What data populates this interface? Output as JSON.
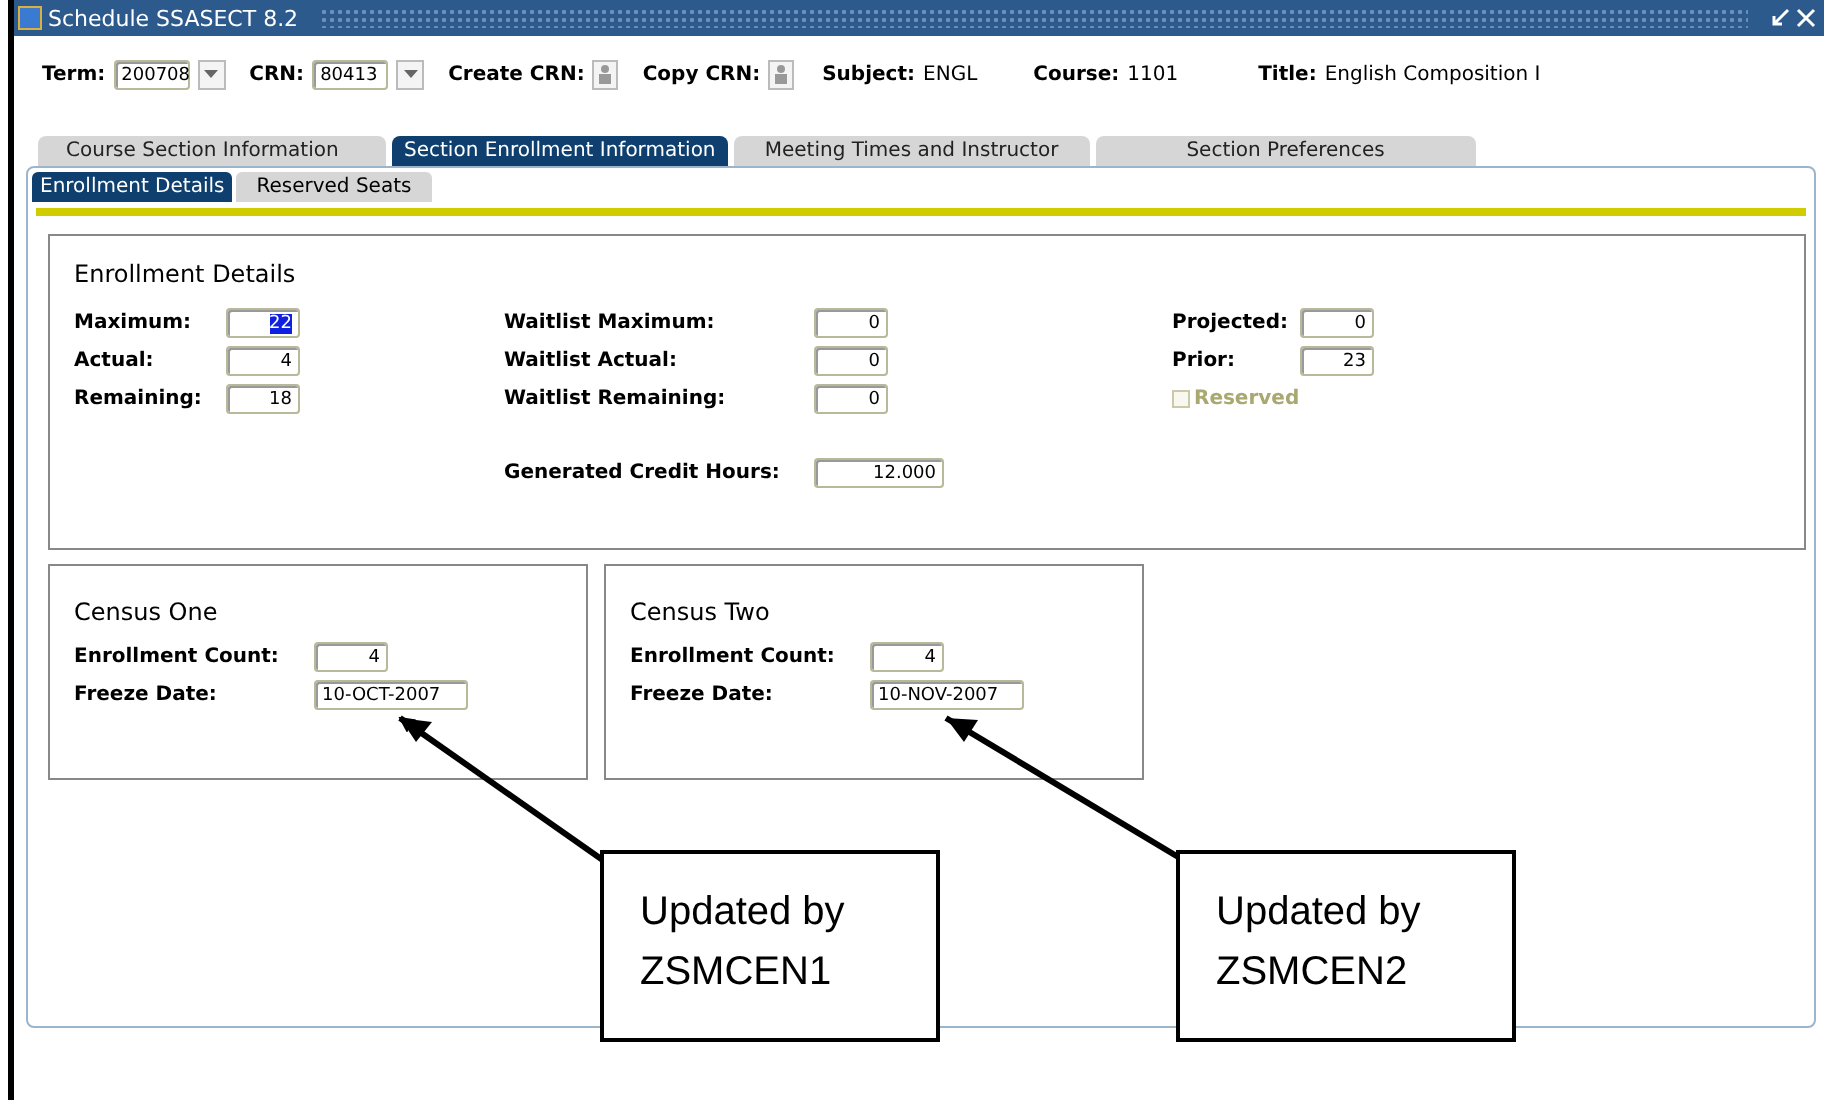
{
  "window": {
    "title": "Schedule  SSASECT  8.2"
  },
  "header": [
    {
      "kind": "dropdown",
      "label": "Term:",
      "value": "200708"
    },
    {
      "kind": "dropdown",
      "label": "CRN:",
      "value": "80413"
    },
    {
      "kind": "button",
      "label": "Create CRN:"
    },
    {
      "kind": "button",
      "label": "Copy CRN:"
    },
    {
      "kind": "text",
      "label": "Subject:",
      "value": "ENGL"
    },
    {
      "kind": "text",
      "label": "Course:",
      "value": "1101"
    },
    {
      "kind": "text",
      "label": "Title:",
      "value": "English Composition I"
    }
  ],
  "tabs": [
    {
      "label": "Course Section Information",
      "selected": false
    },
    {
      "label": "Section Enrollment Information",
      "selected": true
    },
    {
      "label": "Meeting Times and Instructor",
      "selected": false
    },
    {
      "label": "Section Preferences",
      "selected": false
    }
  ],
  "subtabs": [
    {
      "label": "Enrollment Details",
      "selected": true
    },
    {
      "label": "Reserved Seats",
      "selected": false
    }
  ],
  "enrollment": {
    "title": "Enrollment Details",
    "columns": [
      [
        {
          "label": "Maximum:",
          "value": "22",
          "highlighted": true
        },
        {
          "label": "Actual:",
          "value": "4",
          "highlighted": false
        },
        {
          "label": "Remaining:",
          "value": "18",
          "highlighted": false
        }
      ],
      [
        {
          "label": "Waitlist Maximum:",
          "value": "0",
          "highlighted": false
        },
        {
          "label": "Waitlist Actual:",
          "value": "0",
          "highlighted": false
        },
        {
          "label": "Waitlist Remaining:",
          "value": "0",
          "highlighted": false
        }
      ],
      [
        {
          "label": "Projected:",
          "value": "0",
          "highlighted": false
        },
        {
          "label": "Prior:",
          "value": "23",
          "highlighted": false
        }
      ]
    ],
    "reserved": {
      "label": "Reserved",
      "checked": false,
      "disabled": true
    },
    "credit_hours": {
      "label": "Generated Credit Hours:",
      "value": "12.000"
    }
  },
  "census": [
    {
      "title": "Census One",
      "count_label": "Enrollment Count:",
      "count": "4",
      "date_label": "Freeze Date:",
      "date": "10-OCT-2007"
    },
    {
      "title": "Census Two",
      "count_label": "Enrollment Count:",
      "count": "4",
      "date_label": "Freeze Date:",
      "date": "10-NOV-2007"
    }
  ],
  "callouts": [
    {
      "text": "Updated by ZSMCEN1"
    },
    {
      "text": "Updated by ZSMCEN2"
    }
  ]
}
